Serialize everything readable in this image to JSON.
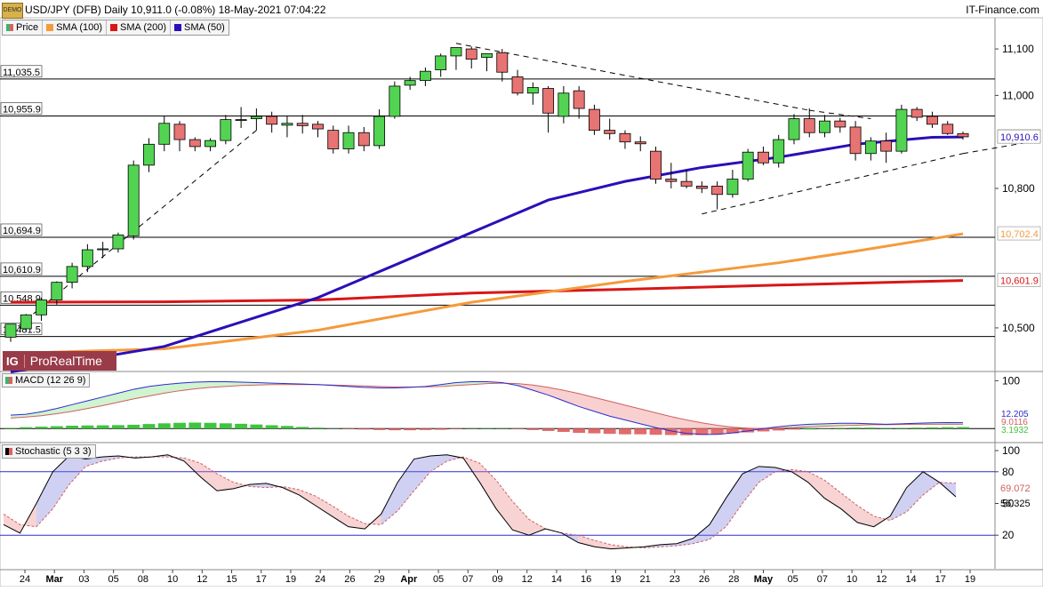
{
  "header": {
    "title": "USD/JPY (DFB) Daily 10,911.0 (-0.08%) 18-May-2021 07:04:22",
    "source": "IT-Finance.com",
    "icon_label": "DEMO"
  },
  "legend": [
    {
      "label": "Price",
      "color": "#3cb371"
    },
    {
      "label": "SMA (100)",
      "color": "#f59a3c"
    },
    {
      "label": "SMA (200)",
      "color": "#d81616"
    },
    {
      "label": "SMA (50)",
      "color": "#2b0fb8"
    }
  ],
  "logo": {
    "badge": "IG",
    "text": "ProRealTime"
  },
  "chart_data": [
    {
      "type": "candlestick",
      "title": "USD/JPY (DFB) Daily",
      "y_ticks": [
        11100,
        11000,
        10800,
        10500
      ],
      "y_tick_labels": [
        "11,100",
        "11,000",
        "10,800",
        "10,500"
      ],
      "ylim": [
        10410,
        11125
      ],
      "x_tick_labels": [
        "24",
        "Mar",
        "03",
        "05",
        "08",
        "10",
        "12",
        "15",
        "17",
        "19",
        "24",
        "26",
        "29",
        "Apr",
        "05",
        "07",
        "09",
        "12",
        "14",
        "16",
        "19",
        "21",
        "23",
        "26",
        "28",
        "May",
        "05",
        "07",
        "10",
        "12",
        "14",
        "17",
        "19"
      ],
      "horizontal_levels": [
        {
          "value": 11035.5,
          "label": "11,035.5"
        },
        {
          "value": 10955.9,
          "label": "10,955.9"
        },
        {
          "value": 10694.9,
          "label": "10,694.9"
        },
        {
          "value": 10610.9,
          "label": "10,610.9"
        },
        {
          "value": 10548.9,
          "label": "10,548.9"
        },
        {
          "value": 10481.5,
          "label": "10,481.5"
        }
      ],
      "price_tags": [
        {
          "label": "10,911.0",
          "value": 10911.0,
          "color": "#f5c400",
          "text_color": "#000"
        },
        {
          "label": "10,910.6",
          "value": 10910.6,
          "color": "#ffffff",
          "text_color": "#2b0fb8"
        },
        {
          "label": "10,702.4",
          "value": 10702.4,
          "color": "#ffffff",
          "text_color": "#f59a3c"
        },
        {
          "label": "10,601.9",
          "value": 10601.9,
          "color": "#ffffff",
          "text_color": "#d81616"
        }
      ],
      "candles": [
        {
          "o": 10480,
          "h": 10500,
          "l": 10470,
          "c": 10508
        },
        {
          "o": 10498,
          "h": 10530,
          "l": 10492,
          "c": 10528
        },
        {
          "o": 10528,
          "h": 10565,
          "l": 10515,
          "c": 10560
        },
        {
          "o": 10560,
          "h": 10600,
          "l": 10550,
          "c": 10598
        },
        {
          "o": 10598,
          "h": 10640,
          "l": 10585,
          "c": 10632
        },
        {
          "o": 10632,
          "h": 10680,
          "l": 10620,
          "c": 10668
        },
        {
          "o": 10668,
          "h": 10685,
          "l": 10650,
          "c": 10670
        },
        {
          "o": 10670,
          "h": 10705,
          "l": 10662,
          "c": 10700
        },
        {
          "o": 10698,
          "h": 10860,
          "l": 10690,
          "c": 10850
        },
        {
          "o": 10850,
          "h": 10908,
          "l": 10835,
          "c": 10895
        },
        {
          "o": 10895,
          "h": 10955,
          "l": 10880,
          "c": 10940
        },
        {
          "o": 10938,
          "h": 10945,
          "l": 10880,
          "c": 10905
        },
        {
          "o": 10905,
          "h": 10910,
          "l": 10880,
          "c": 10890
        },
        {
          "o": 10890,
          "h": 10908,
          "l": 10880,
          "c": 10903
        },
        {
          "o": 10903,
          "h": 10958,
          "l": 10895,
          "c": 10948
        },
        {
          "o": 10948,
          "h": 10975,
          "l": 10930,
          "c": 10948
        },
        {
          "o": 10950,
          "h": 10972,
          "l": 10925,
          "c": 10955
        },
        {
          "o": 10955,
          "h": 10965,
          "l": 10920,
          "c": 10938
        },
        {
          "o": 10936,
          "h": 10955,
          "l": 10910,
          "c": 10940
        },
        {
          "o": 10940,
          "h": 10958,
          "l": 10918,
          "c": 10935
        },
        {
          "o": 10938,
          "h": 10945,
          "l": 10910,
          "c": 10928
        },
        {
          "o": 10925,
          "h": 10935,
          "l": 10875,
          "c": 10885
        },
        {
          "o": 10885,
          "h": 10935,
          "l": 10875,
          "c": 10920
        },
        {
          "o": 10920,
          "h": 10932,
          "l": 10880,
          "c": 10892
        },
        {
          "o": 10892,
          "h": 10970,
          "l": 10885,
          "c": 10955
        },
        {
          "o": 10955,
          "h": 11030,
          "l": 10950,
          "c": 11020
        },
        {
          "o": 11022,
          "h": 11040,
          "l": 11012,
          "c": 11032
        },
        {
          "o": 11032,
          "h": 11060,
          "l": 11020,
          "c": 11052
        },
        {
          "o": 11055,
          "h": 11090,
          "l": 11040,
          "c": 11085
        },
        {
          "o": 11085,
          "h": 11098,
          "l": 11055,
          "c": 11103
        },
        {
          "o": 11100,
          "h": 11105,
          "l": 11058,
          "c": 11078
        },
        {
          "o": 11082,
          "h": 11088,
          "l": 11052,
          "c": 11090
        },
        {
          "o": 11092,
          "h": 11100,
          "l": 11030,
          "c": 11050
        },
        {
          "o": 11040,
          "h": 11055,
          "l": 11000,
          "c": 11005
        },
        {
          "o": 11005,
          "h": 11028,
          "l": 10980,
          "c": 11017
        },
        {
          "o": 11015,
          "h": 11020,
          "l": 10920,
          "c": 10962
        },
        {
          "o": 10955,
          "h": 11020,
          "l": 10940,
          "c": 11005
        },
        {
          "o": 11010,
          "h": 11020,
          "l": 10950,
          "c": 10972
        },
        {
          "o": 10970,
          "h": 10980,
          "l": 10915,
          "c": 10925
        },
        {
          "o": 10925,
          "h": 10950,
          "l": 10905,
          "c": 10918
        },
        {
          "o": 10918,
          "h": 10925,
          "l": 10885,
          "c": 10900
        },
        {
          "o": 10900,
          "h": 10912,
          "l": 10880,
          "c": 10896
        },
        {
          "o": 10880,
          "h": 10890,
          "l": 10810,
          "c": 10820
        },
        {
          "o": 10820,
          "h": 10855,
          "l": 10800,
          "c": 10815
        },
        {
          "o": 10815,
          "h": 10840,
          "l": 10800,
          "c": 10805
        },
        {
          "o": 10805,
          "h": 10815,
          "l": 10790,
          "c": 10800
        },
        {
          "o": 10805,
          "h": 10815,
          "l": 10755,
          "c": 10787
        },
        {
          "o": 10787,
          "h": 10840,
          "l": 10780,
          "c": 10820
        },
        {
          "o": 10820,
          "h": 10885,
          "l": 10815,
          "c": 10878
        },
        {
          "o": 10878,
          "h": 10890,
          "l": 10850,
          "c": 10855
        },
        {
          "o": 10855,
          "h": 10915,
          "l": 10845,
          "c": 10905
        },
        {
          "o": 10905,
          "h": 10960,
          "l": 10895,
          "c": 10950
        },
        {
          "o": 10950,
          "h": 10972,
          "l": 10910,
          "c": 10920
        },
        {
          "o": 10920,
          "h": 10958,
          "l": 10910,
          "c": 10945
        },
        {
          "o": 10945,
          "h": 10952,
          "l": 10920,
          "c": 10932
        },
        {
          "o": 10932,
          "h": 10945,
          "l": 10860,
          "c": 10875
        },
        {
          "o": 10875,
          "h": 10910,
          "l": 10860,
          "c": 10902
        },
        {
          "o": 10902,
          "h": 10920,
          "l": 10855,
          "c": 10880
        },
        {
          "o": 10880,
          "h": 10980,
          "l": 10875,
          "c": 10970
        },
        {
          "o": 10970,
          "h": 10975,
          "l": 10945,
          "c": 10953
        },
        {
          "o": 10955,
          "h": 10965,
          "l": 10930,
          "c": 10938
        },
        {
          "o": 10938,
          "h": 10945,
          "l": 10915,
          "c": 10918
        },
        {
          "o": 10918,
          "h": 10922,
          "l": 10905,
          "c": 10911
        }
      ],
      "sma50": [
        [
          0,
          10405
        ],
        [
          10,
          10460
        ],
        [
          20,
          10565
        ],
        [
          30,
          10705
        ],
        [
          35,
          10775
        ],
        [
          40,
          10815
        ],
        [
          45,
          10845
        ],
        [
          50,
          10867
        ],
        [
          55,
          10895
        ],
        [
          60,
          10910
        ],
        [
          62,
          10910.6
        ]
      ],
      "sma100": [
        [
          0,
          10445
        ],
        [
          10,
          10455
        ],
        [
          20,
          10495
        ],
        [
          30,
          10555
        ],
        [
          40,
          10600
        ],
        [
          50,
          10640
        ],
        [
          55,
          10665
        ],
        [
          62,
          10702.4
        ]
      ],
      "sma200": [
        [
          0,
          10555
        ],
        [
          10,
          10556
        ],
        [
          20,
          10560
        ],
        [
          30,
          10575
        ],
        [
          40,
          10583
        ],
        [
          50,
          10592
        ],
        [
          62,
          10601.9
        ]
      ],
      "trendlines": [
        {
          "points": [
            [
              0,
              10490
            ],
            [
              16,
              10925
            ]
          ],
          "style": "dashed"
        },
        {
          "points": [
            [
              29,
              11112
            ],
            [
              52,
              10968
            ]
          ],
          "style": "dashed"
        },
        {
          "points": [
            [
              52,
              10968
            ],
            [
              56,
              10950
            ]
          ],
          "style": "dashed"
        },
        {
          "points": [
            [
              45,
              10745
            ],
            [
              62,
              10875
            ]
          ],
          "style": "dashed"
        },
        {
          "points": [
            [
              62,
              10875
            ],
            [
              66,
              10898
            ]
          ],
          "style": "dashed"
        }
      ]
    },
    {
      "type": "bar+line",
      "title": "MACD (12 26 9)",
      "y_tick_labels": [
        "100"
      ],
      "value_tags": [
        "12.205",
        "9.0116",
        "3.1932"
      ],
      "histogram": [
        1.5,
        3,
        4,
        5,
        6,
        6.5,
        6.8,
        7.2,
        8,
        9.5,
        11,
        12,
        12.5,
        12,
        11,
        10,
        8.5,
        7,
        5.5,
        3.5,
        2,
        0.5,
        -1,
        -2,
        -3,
        -3.5,
        -3.5,
        -3,
        -2.5,
        -1,
        0.5,
        1,
        0.5,
        -1,
        -3,
        -5,
        -7,
        -9,
        -10,
        -11,
        -12,
        -12,
        -13,
        -13.5,
        -14,
        -13.5,
        -12,
        -10,
        -8,
        -6,
        -4,
        -2,
        0,
        1,
        1.5,
        2,
        2,
        1.5,
        1.5,
        2,
        2.5,
        3,
        3.2
      ],
      "macd": [
        28,
        30,
        35,
        42,
        50,
        58,
        66,
        74,
        82,
        88,
        92,
        95,
        97,
        98,
        98,
        97,
        96,
        95,
        94,
        93,
        92,
        90,
        88,
        86,
        85,
        85,
        86,
        88,
        92,
        96,
        98,
        98,
        96,
        90,
        80,
        70,
        58,
        46,
        36,
        26,
        18,
        10,
        2,
        -5,
        -10,
        -12,
        -12,
        -9,
        -5,
        0,
        4,
        7,
        9,
        10,
        11,
        11,
        10,
        9,
        10,
        11,
        12,
        12.5,
        12.2
      ],
      "signal": [
        22,
        24,
        27,
        31,
        36,
        42,
        48,
        55,
        62,
        68,
        74,
        79,
        83,
        86,
        88,
        90,
        91,
        92,
        92,
        92,
        92,
        91,
        90,
        89,
        88,
        87,
        87,
        87,
        88,
        90,
        92,
        94,
        95,
        94,
        91,
        86,
        80,
        73,
        65,
        57,
        49,
        41,
        33,
        25,
        18,
        12,
        7,
        3,
        1,
        0,
        1,
        2,
        4,
        5,
        6,
        7,
        8,
        8,
        8.5,
        9,
        9,
        9,
        9.0
      ]
    },
    {
      "type": "line",
      "title": "Stochastic (5 3 3)",
      "y_ticks": [
        100,
        80,
        50,
        20
      ],
      "y_tick_labels": [
        "100",
        "80",
        "50",
        "20"
      ],
      "overbought": 80,
      "oversold": 20,
      "value_tags": [
        "69.072",
        "56.325"
      ],
      "k": [
        30,
        22,
        50,
        80,
        95,
        92,
        94,
        95,
        93,
        94,
        96,
        90,
        75,
        62,
        64,
        68,
        69,
        65,
        58,
        48,
        38,
        28,
        26,
        40,
        70,
        92,
        95,
        96,
        93,
        70,
        45,
        25,
        20,
        26,
        22,
        13,
        9,
        7,
        8,
        9,
        11,
        12,
        17,
        30,
        55,
        78,
        85,
        84,
        80,
        70,
        55,
        45,
        32,
        28,
        38,
        65,
        80,
        70,
        56.325
      ],
      "d": [
        40,
        30,
        28,
        45,
        68,
        85,
        90,
        93,
        94,
        94,
        94,
        93,
        88,
        78,
        70,
        66,
        65,
        66,
        63,
        57,
        48,
        38,
        31,
        30,
        43,
        62,
        80,
        90,
        94,
        88,
        72,
        52,
        35,
        26,
        22,
        20,
        15,
        11,
        9,
        8,
        9,
        10,
        12,
        16,
        28,
        50,
        70,
        80,
        82,
        80,
        72,
        60,
        48,
        38,
        34,
        42,
        58,
        70,
        69.072
      ]
    }
  ]
}
